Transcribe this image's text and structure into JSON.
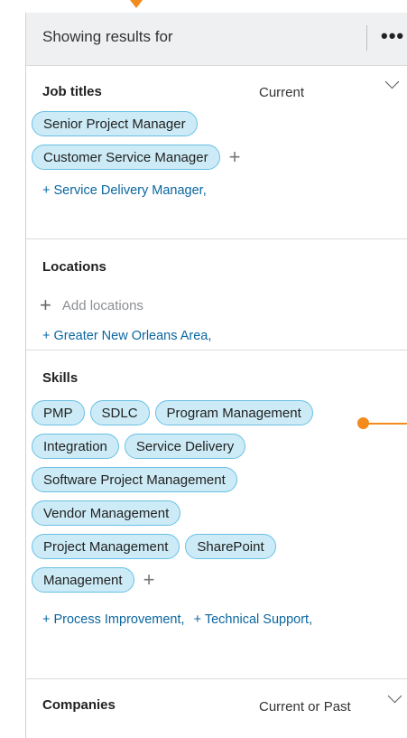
{
  "header": {
    "title": "Showing results for",
    "more_label": "•••"
  },
  "job_titles": {
    "title": "Job titles",
    "scope": "Current",
    "pills": [
      "Senior Project Manager",
      "Customer Service Manager"
    ],
    "add_label": "+",
    "suggestions": [
      "+ Service Delivery Manager,"
    ]
  },
  "locations": {
    "title": "Locations",
    "add_placeholder": "Add locations",
    "add_icon": "+",
    "suggestions": [
      "+ Greater New Orleans Area,"
    ]
  },
  "skills": {
    "title": "Skills",
    "pills": [
      "PMP",
      "SDLC",
      "Program Management",
      "Integration",
      "Service Delivery",
      "Software Project Management",
      "Vendor Management",
      "Project Management",
      "SharePoint",
      "Management"
    ],
    "add_label": "+",
    "suggestions": [
      "+ Process Improvement,",
      "+ Technical Support,"
    ]
  },
  "companies": {
    "title": "Companies",
    "scope": "Current or Past"
  },
  "colors": {
    "pill_bg": "#ccebf6",
    "pill_border": "#69c0e4",
    "link": "#0a66a0",
    "annotation": "#f28a1c"
  }
}
